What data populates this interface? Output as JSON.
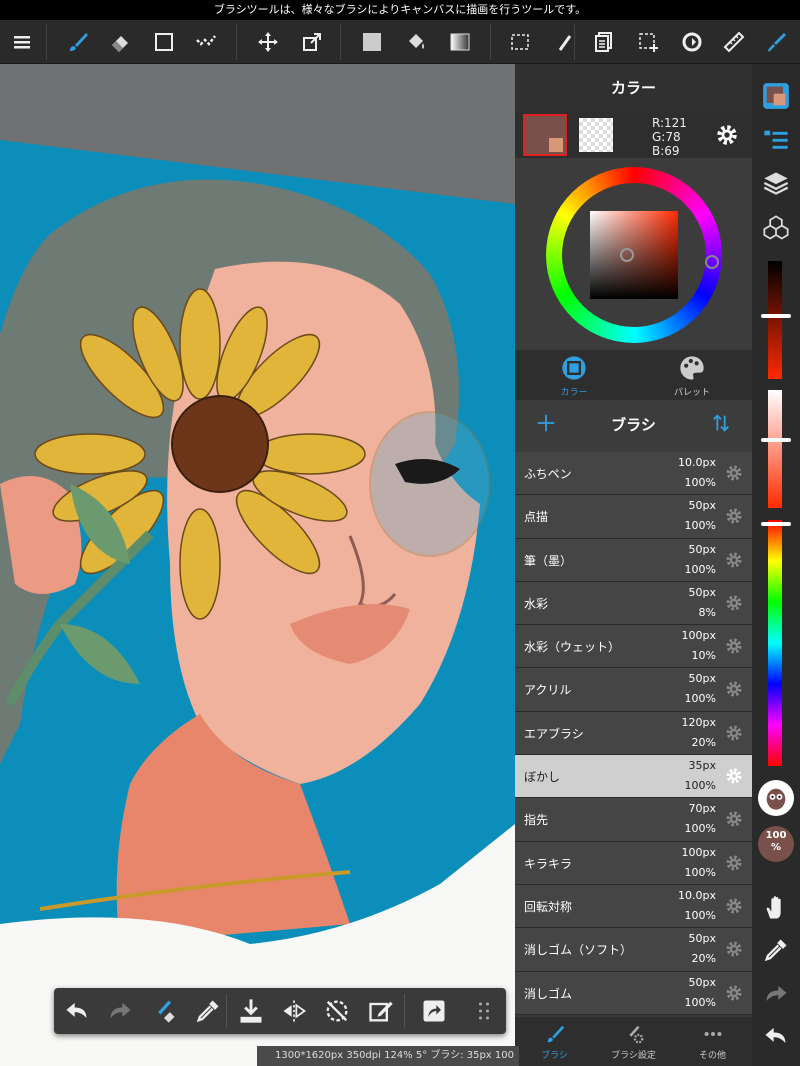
{
  "tip": "ブラシツールは、様々なブラシによりキャンバスに描画を行うツールです。",
  "color_panel": {
    "title": "カラー",
    "main_color": "#79504a",
    "rgb": {
      "r": "R:121",
      "g": "G:78",
      "b": "B:69"
    },
    "tabs": [
      {
        "label": "カラー",
        "active": true
      },
      {
        "label": "パレット",
        "active": false
      }
    ]
  },
  "brush_panel": {
    "title": "ブラシ",
    "brushes": [
      {
        "name": "ふちペン",
        "size": "10.0px",
        "opacity": "100%"
      },
      {
        "name": "点描",
        "size": "50px",
        "opacity": "100%"
      },
      {
        "name": "筆（墨）",
        "size": "50px",
        "opacity": "100%"
      },
      {
        "name": "水彩",
        "size": "50px",
        "opacity": "8%"
      },
      {
        "name": "水彩（ウェット）",
        "size": "100px",
        "opacity": "10%"
      },
      {
        "name": "アクリル",
        "size": "50px",
        "opacity": "100%"
      },
      {
        "name": "エアブラシ",
        "size": "120px",
        "opacity": "20%"
      },
      {
        "name": "ぼかし",
        "size": "35px",
        "opacity": "100%",
        "selected": true
      },
      {
        "name": "指先",
        "size": "70px",
        "opacity": "100%"
      },
      {
        "name": "キラキラ",
        "size": "100px",
        "opacity": "100%"
      },
      {
        "name": "回転対称",
        "size": "10.0px",
        "opacity": "100%"
      },
      {
        "name": "消しゴム（ソフト）",
        "size": "50px",
        "opacity": "20%"
      },
      {
        "name": "消しゴム",
        "size": "50px",
        "opacity": "100%"
      }
    ]
  },
  "bottom_tabs": [
    {
      "label": "ブラシ",
      "active": true
    },
    {
      "label": "ブラシ設定",
      "active": false
    },
    {
      "label": "その他",
      "active": false
    }
  ],
  "right_bar": {
    "opacity_label": "100\n%"
  },
  "status": "1300*1620px 350dpi 124% 5° ブラシ: 35px 100",
  "colors": {
    "accent": "#2f9fe0",
    "bg": "#2b2b2b"
  }
}
